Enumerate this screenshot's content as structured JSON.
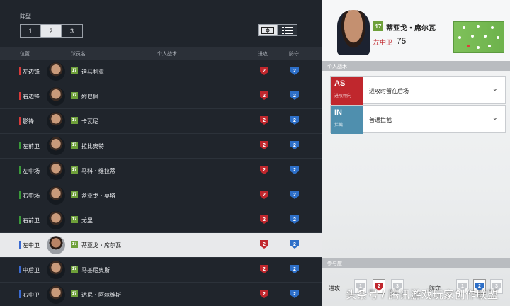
{
  "formation": {
    "label": "阵型",
    "tabs": [
      "1",
      "2",
      "3"
    ],
    "active_tab": "2"
  },
  "view_toggle": {
    "pitch_icon": "pitch-view-icon",
    "list_icon": "list-view-icon",
    "active": "list"
  },
  "columns": {
    "position": "位置",
    "player": "球员名",
    "tactic": "个人战术",
    "attack": "进攻",
    "defense": "防守"
  },
  "players": [
    {
      "pos": "左边锋",
      "rating": "17",
      "name": "迪马利亚",
      "attack": "2",
      "defense": "2",
      "pos_color": "#d83a3a"
    },
    {
      "pos": "右边锋",
      "rating": "17",
      "name": "姆巴佩",
      "attack": "2",
      "defense": "2",
      "pos_color": "#d83a3a"
    },
    {
      "pos": "影锋",
      "rating": "17",
      "name": "卡瓦尼",
      "attack": "2",
      "defense": "2",
      "pos_color": "#d83a3a"
    },
    {
      "pos": "左前卫",
      "rating": "17",
      "name": "拉比奥特",
      "attack": "2",
      "defense": "2",
      "pos_color": "#3a9a3a"
    },
    {
      "pos": "左中场",
      "rating": "17",
      "name": "马科・维拉蒂",
      "attack": "2",
      "defense": "2",
      "pos_color": "#3a9a3a"
    },
    {
      "pos": "右中场",
      "rating": "17",
      "name": "蒂亚戈・莫塔",
      "attack": "2",
      "defense": "2",
      "pos_color": "#3a9a3a"
    },
    {
      "pos": "右前卫",
      "rating": "17",
      "name": "尤里",
      "attack": "2",
      "defense": "2",
      "pos_color": "#3a9a3a"
    },
    {
      "pos": "左中卫",
      "rating": "17",
      "name": "蒂亚戈・席尔瓦",
      "attack": "2",
      "defense": "2",
      "pos_color": "#3a6ad0"
    },
    {
      "pos": "中后卫",
      "rating": "17",
      "name": "马基尼奥斯",
      "attack": "2",
      "defense": "2",
      "pos_color": "#3a6ad0"
    },
    {
      "pos": "右中卫",
      "rating": "17",
      "name": "达尼・阿尔维斯",
      "attack": "2",
      "defense": "2",
      "pos_color": "#3a6ad0"
    }
  ],
  "selected_index": 7,
  "detail": {
    "rating": "17",
    "name": "蒂亚戈・席尔瓦",
    "position": "左中卫",
    "overall": "75",
    "tactics_header": "个人战术",
    "tactics": [
      {
        "code": "AS",
        "sub": "进攻倾向",
        "value": "进攻时留在后场",
        "color": "#c0272d"
      },
      {
        "code": "IN",
        "sub": "拦截",
        "value": "普通拦截",
        "color": "#4f8fae"
      }
    ],
    "participation_header": "参与度",
    "attack_label": "进攻",
    "defense_label": "防守",
    "attack_levels": [
      "1",
      "2",
      "3"
    ],
    "defense_levels": [
      "1",
      "2",
      "3"
    ],
    "active_level": "2"
  },
  "watermark": "头条号 / 腾讯游戏玩家创作联盟"
}
